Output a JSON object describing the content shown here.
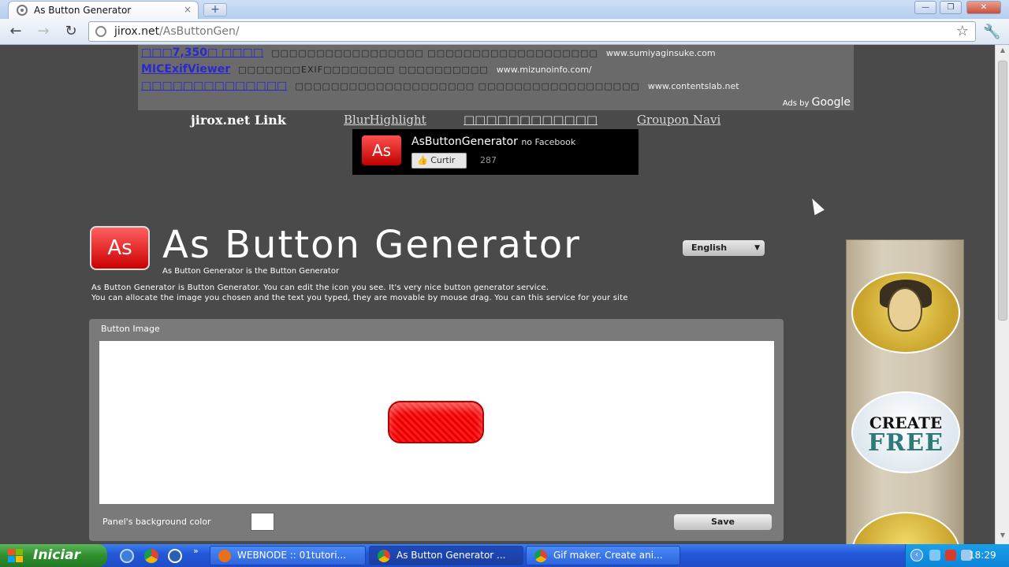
{
  "browser": {
    "tab_title": "As Button Generator",
    "tab_close": "×",
    "new_tab": "+",
    "url_domain": "jirox.net",
    "url_path": "/AsButtonGen/",
    "window_controls": {
      "minimize": "—",
      "maximize": "❐",
      "close": "✕"
    }
  },
  "ads": {
    "rows": [
      {
        "title": "□□□7,350□ □□□□",
        "desc": "□□□□□□□□□□□□□□□□□ □□□□□□□□□□□□□□□□□□□",
        "url": "www.sumiyaginsuke.com"
      },
      {
        "title": "MICExifViewer",
        "desc": "□□□□□□□EXIF□□□□□□□□ □□□□□□□□□□",
        "url": "www.mizunoinfo.com/"
      },
      {
        "title": "□□□□□□□□□□□□□□",
        "desc": "□□□□□□□□□□□□□□□□□□□□ □□□□□□□□□□□□□□□□□□",
        "url": "www.contentslab.net"
      }
    ],
    "ads_by": "Ads by",
    "google": "Google"
  },
  "links": {
    "heading": "jirox.net Link",
    "items": [
      "BlurHighlight",
      "□□□□□□□□□□□□",
      "Groupon Navi"
    ]
  },
  "facebook": {
    "logo": "As",
    "name": "AsButtonGenerator",
    "suffix": "no Facebook",
    "like_label": "Curtir",
    "like_count": "287"
  },
  "app": {
    "logo": "As",
    "title": "As Button Generator",
    "subtitle": "As Button Generator is the Button Generator",
    "language": "English",
    "description_1": "As Button Generator is Button Generator. You can edit the icon you see. It's very nice button generator service.",
    "description_2": "You can allocate the image you chosen and the text you typed, they are movable by mouse drag. You can this service for your site"
  },
  "panel": {
    "label": "Button Image",
    "bg_color_label": "Panel's background color",
    "bg_color": "#ffffff",
    "save_label": "Save",
    "button_color": "#e60000"
  },
  "side_ad": {
    "create": "CREATE",
    "free": "FREE"
  },
  "taskbar": {
    "start_label": "Iniciar",
    "more": "»",
    "items": [
      {
        "label": "WEBNODE :: 01tutori...",
        "icon_color": "#e8701a"
      },
      {
        "label": "As Button Generator ...",
        "icon_color": "#3aa83a"
      },
      {
        "label": "Gif maker. Create ani...",
        "icon_color": "#3aa83a"
      }
    ],
    "clock": "18:29"
  }
}
